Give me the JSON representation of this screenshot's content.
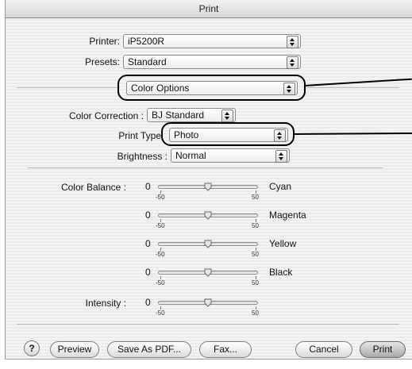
{
  "window": {
    "title": "Print"
  },
  "printer": {
    "label": "Printer:",
    "value": "iP5200R"
  },
  "presets": {
    "label": "Presets:",
    "value": "Standard"
  },
  "panel": {
    "value": "Color Options"
  },
  "color_correction": {
    "label": "Color Correction :",
    "value": "BJ Standard"
  },
  "print_type": {
    "label": "Print Type",
    "value": "Photo"
  },
  "brightness": {
    "label": "Brightness :",
    "value": "Normal"
  },
  "color_balance": {
    "label": "Color Balance :",
    "min_label": "-50",
    "max_label": "50",
    "sliders": [
      {
        "name": "Cyan",
        "value": "0",
        "level": 0
      },
      {
        "name": "Magenta",
        "value": "0",
        "level": 0
      },
      {
        "name": "Yellow",
        "value": "0",
        "level": 0
      },
      {
        "name": "Black",
        "value": "0",
        "level": 0
      }
    ]
  },
  "intensity": {
    "label": "Intensity :",
    "value": "0",
    "level": 0,
    "min_label": "-50",
    "max_label": "50"
  },
  "buttons": {
    "help": "?",
    "preview": "Preview",
    "save_pdf": "Save As PDF...",
    "fax": "Fax...",
    "cancel": "Cancel",
    "print": "Print"
  }
}
